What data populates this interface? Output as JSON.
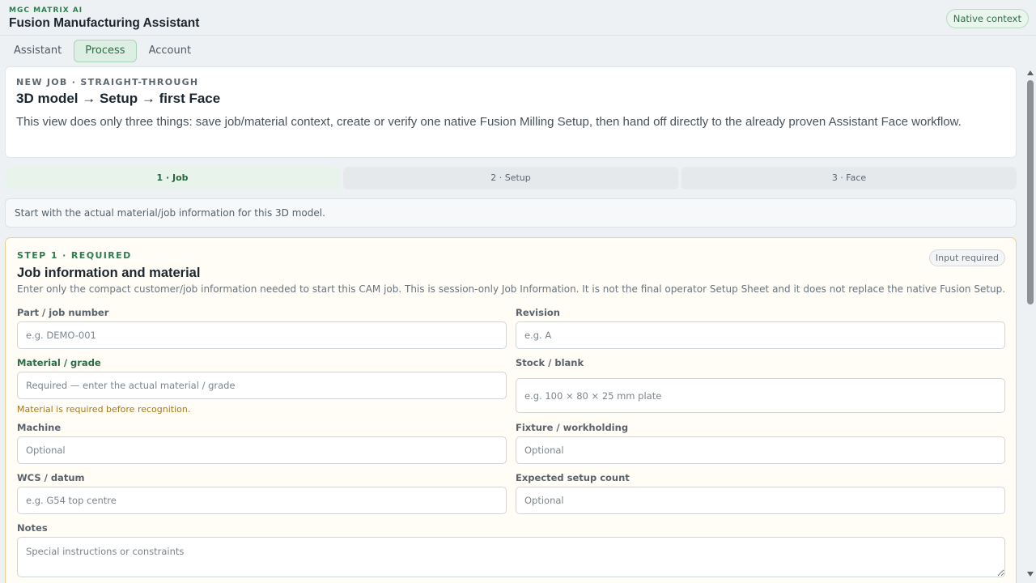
{
  "app": {
    "brand": "MGC MATRIX AI",
    "title": "Fusion Manufacturing Assistant",
    "context_badge": "Native context"
  },
  "tabs": [
    {
      "label": "Assistant",
      "active": false
    },
    {
      "label": "Process",
      "active": true
    },
    {
      "label": "Account",
      "active": false
    }
  ],
  "intro": {
    "eyebrow": "NEW JOB · STRAIGHT-THROUGH",
    "title": "3D model → Setup → first Face",
    "description": "This view does only three things: save job/material context, create or verify one native Fusion Milling Setup, then hand off directly to the already proven Assistant Face workflow."
  },
  "steps": [
    {
      "label": "1 · Job",
      "active": true
    },
    {
      "label": "2 · Setup",
      "active": false
    },
    {
      "label": "3 · Face",
      "active": false
    }
  ],
  "hint": "Start with the actual material/job information for this 3D model.",
  "form": {
    "eyebrow": "STEP 1 · REQUIRED",
    "title": "Job information and material",
    "description": "Enter only the compact customer/job information needed to start this CAM job. This is session-only Job Information. It is not the final operator Setup Sheet and it does not replace the native Fusion Setup.",
    "badge": "Input required",
    "fields": {
      "part": {
        "label": "Part / job number",
        "placeholder": "e.g. DEMO-001",
        "value": ""
      },
      "revision": {
        "label": "Revision",
        "placeholder": "e.g. A",
        "value": ""
      },
      "material": {
        "label": "Material / grade",
        "placeholder": "Required — enter the actual material / grade",
        "value": "",
        "warning": "Material is required before recognition."
      },
      "stock": {
        "label": "Stock / blank",
        "placeholder": "e.g. 100 × 80 × 25 mm plate",
        "value": ""
      },
      "machine": {
        "label": "Machine",
        "placeholder": "Optional",
        "value": ""
      },
      "fixture": {
        "label": "Fixture / workholding",
        "placeholder": "Optional",
        "value": ""
      },
      "wcs": {
        "label": "WCS / datum",
        "placeholder": "e.g. G54 top centre",
        "value": ""
      },
      "setup_count": {
        "label": "Expected setup count",
        "placeholder": "Optional",
        "value": ""
      },
      "notes": {
        "label": "Notes",
        "placeholder": "Special instructions or constraints",
        "value": ""
      }
    }
  },
  "colors": {
    "accent": "#2e7d4f",
    "warning": "#a57817",
    "card_border": "#f0cf8c"
  }
}
